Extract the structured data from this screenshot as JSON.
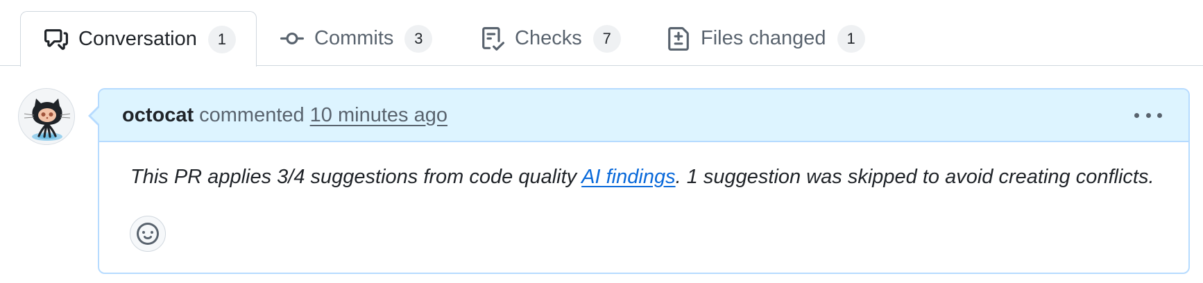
{
  "tabs": [
    {
      "label": "Conversation",
      "count": "1",
      "icon": "comment-discussion-icon",
      "active": true
    },
    {
      "label": "Commits",
      "count": "3",
      "icon": "git-commit-icon",
      "active": false
    },
    {
      "label": "Checks",
      "count": "7",
      "icon": "checklist-icon",
      "active": false
    },
    {
      "label": "Files changed",
      "count": "1",
      "icon": "file-diff-icon",
      "active": false
    }
  ],
  "comment": {
    "author": "octocat",
    "action": "commented",
    "timestamp": "10 minutes ago",
    "body_before": "This PR applies 3/4 suggestions from code quality ",
    "body_link": "AI findings",
    "body_after": ". 1 suggestion was skipped to avoid creating conflicts.",
    "header_bg": "#ddf4ff",
    "border_color": "#b6dbff",
    "link_color": "#0969da"
  }
}
